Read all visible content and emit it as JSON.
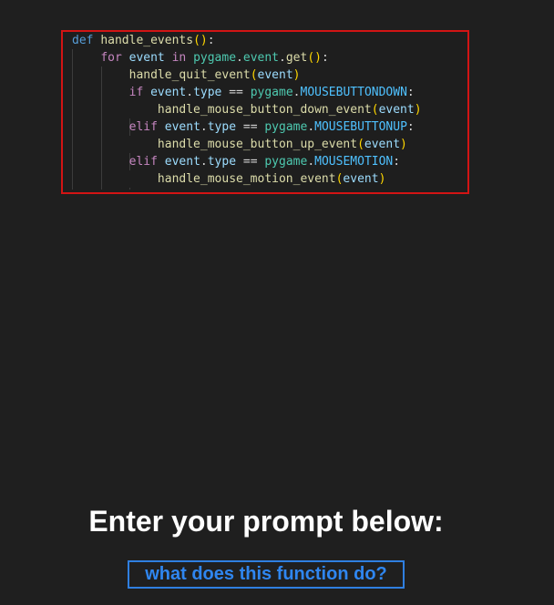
{
  "code": {
    "lines": [
      [
        {
          "t": "def",
          "c": "kw-def"
        },
        {
          "t": " ",
          "c": "op"
        },
        {
          "t": "handle_events",
          "c": "fn"
        },
        {
          "t": "()",
          "c": "paren"
        },
        {
          "t": ":",
          "c": "op"
        }
      ],
      [
        {
          "t": "    ",
          "c": "op"
        },
        {
          "t": "for",
          "c": "kw-ctl"
        },
        {
          "t": " ",
          "c": "op"
        },
        {
          "t": "event",
          "c": "var"
        },
        {
          "t": " ",
          "c": "op"
        },
        {
          "t": "in",
          "c": "kw-ctl"
        },
        {
          "t": " ",
          "c": "op"
        },
        {
          "t": "pygame",
          "c": "mod"
        },
        {
          "t": ".",
          "c": "op"
        },
        {
          "t": "event",
          "c": "mod"
        },
        {
          "t": ".",
          "c": "op"
        },
        {
          "t": "get",
          "c": "fn"
        },
        {
          "t": "()",
          "c": "paren"
        },
        {
          "t": ":",
          "c": "op"
        }
      ],
      [
        {
          "t": "        ",
          "c": "op"
        },
        {
          "t": "handle_quit_event",
          "c": "fn"
        },
        {
          "t": "(",
          "c": "paren"
        },
        {
          "t": "event",
          "c": "var"
        },
        {
          "t": ")",
          "c": "paren"
        }
      ],
      [
        {
          "t": "        ",
          "c": "op"
        },
        {
          "t": "if",
          "c": "kw-ctl"
        },
        {
          "t": " ",
          "c": "op"
        },
        {
          "t": "event",
          "c": "var"
        },
        {
          "t": ".",
          "c": "op"
        },
        {
          "t": "type",
          "c": "var"
        },
        {
          "t": " == ",
          "c": "op"
        },
        {
          "t": "pygame",
          "c": "mod"
        },
        {
          "t": ".",
          "c": "op"
        },
        {
          "t": "MOUSEBUTTONDOWN",
          "c": "const"
        },
        {
          "t": ":",
          "c": "op"
        }
      ],
      [
        {
          "t": "            ",
          "c": "op"
        },
        {
          "t": "handle_mouse_button_down_event",
          "c": "fn"
        },
        {
          "t": "(",
          "c": "paren"
        },
        {
          "t": "event",
          "c": "var"
        },
        {
          "t": ")",
          "c": "paren"
        }
      ],
      [
        {
          "t": "        ",
          "c": "op"
        },
        {
          "t": "elif",
          "c": "kw-ctl"
        },
        {
          "t": " ",
          "c": "op"
        },
        {
          "t": "event",
          "c": "var"
        },
        {
          "t": ".",
          "c": "op"
        },
        {
          "t": "type",
          "c": "var"
        },
        {
          "t": " == ",
          "c": "op"
        },
        {
          "t": "pygame",
          "c": "mod"
        },
        {
          "t": ".",
          "c": "op"
        },
        {
          "t": "MOUSEBUTTONUP",
          "c": "const"
        },
        {
          "t": ":",
          "c": "op"
        }
      ],
      [
        {
          "t": "            ",
          "c": "op"
        },
        {
          "t": "handle_mouse_button_up_event",
          "c": "fn"
        },
        {
          "t": "(",
          "c": "paren"
        },
        {
          "t": "event",
          "c": "var"
        },
        {
          "t": ")",
          "c": "paren"
        }
      ],
      [
        {
          "t": "        ",
          "c": "op"
        },
        {
          "t": "elif",
          "c": "kw-ctl"
        },
        {
          "t": " ",
          "c": "op"
        },
        {
          "t": "event",
          "c": "var"
        },
        {
          "t": ".",
          "c": "op"
        },
        {
          "t": "type",
          "c": "var"
        },
        {
          "t": " == ",
          "c": "op"
        },
        {
          "t": "pygame",
          "c": "mod"
        },
        {
          "t": ".",
          "c": "op"
        },
        {
          "t": "MOUSEMOTION",
          "c": "const"
        },
        {
          "t": ":",
          "c": "op"
        }
      ],
      [
        {
          "t": "            ",
          "c": "op"
        },
        {
          "t": "handle_mouse_motion_event",
          "c": "fn"
        },
        {
          "t": "(",
          "c": "paren"
        },
        {
          "t": "event",
          "c": "var"
        },
        {
          "t": ")",
          "c": "paren"
        }
      ]
    ]
  },
  "prompt": {
    "title": "Enter your prompt below:",
    "value": "what does this function do?"
  },
  "colors": {
    "background": "#1f1f1f",
    "highlight_border": "#d21414",
    "prompt_accent": "#2f86f0"
  }
}
